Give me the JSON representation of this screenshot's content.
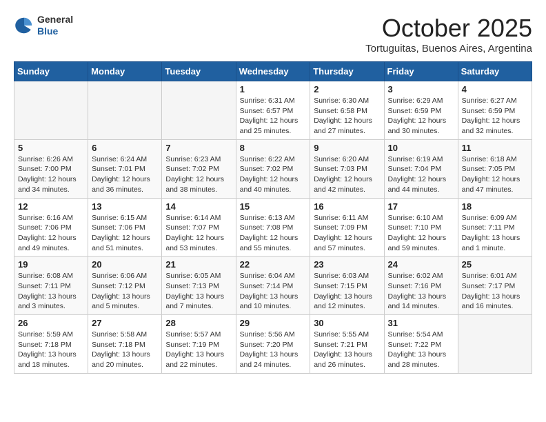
{
  "logo": {
    "general": "General",
    "blue": "Blue"
  },
  "header": {
    "month": "October 2025",
    "location": "Tortuguitas, Buenos Aires, Argentina"
  },
  "days_of_week": [
    "Sunday",
    "Monday",
    "Tuesday",
    "Wednesday",
    "Thursday",
    "Friday",
    "Saturday"
  ],
  "weeks": [
    [
      {
        "num": "",
        "info": ""
      },
      {
        "num": "",
        "info": ""
      },
      {
        "num": "",
        "info": ""
      },
      {
        "num": "1",
        "info": "Sunrise: 6:31 AM\nSunset: 6:57 PM\nDaylight: 12 hours\nand 25 minutes."
      },
      {
        "num": "2",
        "info": "Sunrise: 6:30 AM\nSunset: 6:58 PM\nDaylight: 12 hours\nand 27 minutes."
      },
      {
        "num": "3",
        "info": "Sunrise: 6:29 AM\nSunset: 6:59 PM\nDaylight: 12 hours\nand 30 minutes."
      },
      {
        "num": "4",
        "info": "Sunrise: 6:27 AM\nSunset: 6:59 PM\nDaylight: 12 hours\nand 32 minutes."
      }
    ],
    [
      {
        "num": "5",
        "info": "Sunrise: 6:26 AM\nSunset: 7:00 PM\nDaylight: 12 hours\nand 34 minutes."
      },
      {
        "num": "6",
        "info": "Sunrise: 6:24 AM\nSunset: 7:01 PM\nDaylight: 12 hours\nand 36 minutes."
      },
      {
        "num": "7",
        "info": "Sunrise: 6:23 AM\nSunset: 7:02 PM\nDaylight: 12 hours\nand 38 minutes."
      },
      {
        "num": "8",
        "info": "Sunrise: 6:22 AM\nSunset: 7:02 PM\nDaylight: 12 hours\nand 40 minutes."
      },
      {
        "num": "9",
        "info": "Sunrise: 6:20 AM\nSunset: 7:03 PM\nDaylight: 12 hours\nand 42 minutes."
      },
      {
        "num": "10",
        "info": "Sunrise: 6:19 AM\nSunset: 7:04 PM\nDaylight: 12 hours\nand 44 minutes."
      },
      {
        "num": "11",
        "info": "Sunrise: 6:18 AM\nSunset: 7:05 PM\nDaylight: 12 hours\nand 47 minutes."
      }
    ],
    [
      {
        "num": "12",
        "info": "Sunrise: 6:16 AM\nSunset: 7:06 PM\nDaylight: 12 hours\nand 49 minutes."
      },
      {
        "num": "13",
        "info": "Sunrise: 6:15 AM\nSunset: 7:06 PM\nDaylight: 12 hours\nand 51 minutes."
      },
      {
        "num": "14",
        "info": "Sunrise: 6:14 AM\nSunset: 7:07 PM\nDaylight: 12 hours\nand 53 minutes."
      },
      {
        "num": "15",
        "info": "Sunrise: 6:13 AM\nSunset: 7:08 PM\nDaylight: 12 hours\nand 55 minutes."
      },
      {
        "num": "16",
        "info": "Sunrise: 6:11 AM\nSunset: 7:09 PM\nDaylight: 12 hours\nand 57 minutes."
      },
      {
        "num": "17",
        "info": "Sunrise: 6:10 AM\nSunset: 7:10 PM\nDaylight: 12 hours\nand 59 minutes."
      },
      {
        "num": "18",
        "info": "Sunrise: 6:09 AM\nSunset: 7:11 PM\nDaylight: 13 hours\nand 1 minute."
      }
    ],
    [
      {
        "num": "19",
        "info": "Sunrise: 6:08 AM\nSunset: 7:11 PM\nDaylight: 13 hours\nand 3 minutes."
      },
      {
        "num": "20",
        "info": "Sunrise: 6:06 AM\nSunset: 7:12 PM\nDaylight: 13 hours\nand 5 minutes."
      },
      {
        "num": "21",
        "info": "Sunrise: 6:05 AM\nSunset: 7:13 PM\nDaylight: 13 hours\nand 7 minutes."
      },
      {
        "num": "22",
        "info": "Sunrise: 6:04 AM\nSunset: 7:14 PM\nDaylight: 13 hours\nand 10 minutes."
      },
      {
        "num": "23",
        "info": "Sunrise: 6:03 AM\nSunset: 7:15 PM\nDaylight: 13 hours\nand 12 minutes."
      },
      {
        "num": "24",
        "info": "Sunrise: 6:02 AM\nSunset: 7:16 PM\nDaylight: 13 hours\nand 14 minutes."
      },
      {
        "num": "25",
        "info": "Sunrise: 6:01 AM\nSunset: 7:17 PM\nDaylight: 13 hours\nand 16 minutes."
      }
    ],
    [
      {
        "num": "26",
        "info": "Sunrise: 5:59 AM\nSunset: 7:18 PM\nDaylight: 13 hours\nand 18 minutes."
      },
      {
        "num": "27",
        "info": "Sunrise: 5:58 AM\nSunset: 7:18 PM\nDaylight: 13 hours\nand 20 minutes."
      },
      {
        "num": "28",
        "info": "Sunrise: 5:57 AM\nSunset: 7:19 PM\nDaylight: 13 hours\nand 22 minutes."
      },
      {
        "num": "29",
        "info": "Sunrise: 5:56 AM\nSunset: 7:20 PM\nDaylight: 13 hours\nand 24 minutes."
      },
      {
        "num": "30",
        "info": "Sunrise: 5:55 AM\nSunset: 7:21 PM\nDaylight: 13 hours\nand 26 minutes."
      },
      {
        "num": "31",
        "info": "Sunrise: 5:54 AM\nSunset: 7:22 PM\nDaylight: 13 hours\nand 28 minutes."
      },
      {
        "num": "",
        "info": ""
      }
    ]
  ]
}
